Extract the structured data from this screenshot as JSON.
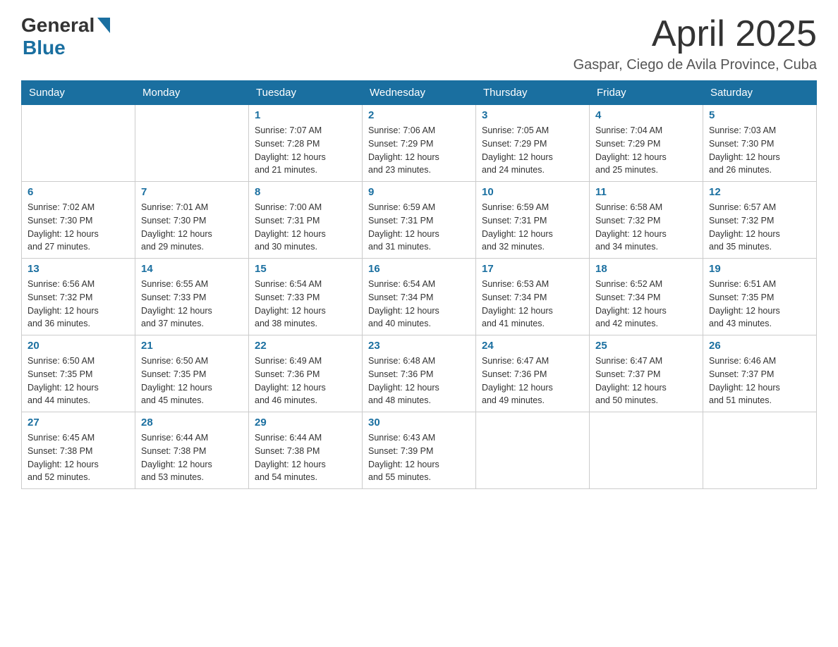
{
  "header": {
    "logo_general": "General",
    "logo_blue": "Blue",
    "title": "April 2025",
    "location": "Gaspar, Ciego de Avila Province, Cuba"
  },
  "columns": [
    "Sunday",
    "Monday",
    "Tuesday",
    "Wednesday",
    "Thursday",
    "Friday",
    "Saturday"
  ],
  "weeks": [
    [
      {
        "day": "",
        "info": ""
      },
      {
        "day": "",
        "info": ""
      },
      {
        "day": "1",
        "info": "Sunrise: 7:07 AM\nSunset: 7:28 PM\nDaylight: 12 hours\nand 21 minutes."
      },
      {
        "day": "2",
        "info": "Sunrise: 7:06 AM\nSunset: 7:29 PM\nDaylight: 12 hours\nand 23 minutes."
      },
      {
        "day": "3",
        "info": "Sunrise: 7:05 AM\nSunset: 7:29 PM\nDaylight: 12 hours\nand 24 minutes."
      },
      {
        "day": "4",
        "info": "Sunrise: 7:04 AM\nSunset: 7:29 PM\nDaylight: 12 hours\nand 25 minutes."
      },
      {
        "day": "5",
        "info": "Sunrise: 7:03 AM\nSunset: 7:30 PM\nDaylight: 12 hours\nand 26 minutes."
      }
    ],
    [
      {
        "day": "6",
        "info": "Sunrise: 7:02 AM\nSunset: 7:30 PM\nDaylight: 12 hours\nand 27 minutes."
      },
      {
        "day": "7",
        "info": "Sunrise: 7:01 AM\nSunset: 7:30 PM\nDaylight: 12 hours\nand 29 minutes."
      },
      {
        "day": "8",
        "info": "Sunrise: 7:00 AM\nSunset: 7:31 PM\nDaylight: 12 hours\nand 30 minutes."
      },
      {
        "day": "9",
        "info": "Sunrise: 6:59 AM\nSunset: 7:31 PM\nDaylight: 12 hours\nand 31 minutes."
      },
      {
        "day": "10",
        "info": "Sunrise: 6:59 AM\nSunset: 7:31 PM\nDaylight: 12 hours\nand 32 minutes."
      },
      {
        "day": "11",
        "info": "Sunrise: 6:58 AM\nSunset: 7:32 PM\nDaylight: 12 hours\nand 34 minutes."
      },
      {
        "day": "12",
        "info": "Sunrise: 6:57 AM\nSunset: 7:32 PM\nDaylight: 12 hours\nand 35 minutes."
      }
    ],
    [
      {
        "day": "13",
        "info": "Sunrise: 6:56 AM\nSunset: 7:32 PM\nDaylight: 12 hours\nand 36 minutes."
      },
      {
        "day": "14",
        "info": "Sunrise: 6:55 AM\nSunset: 7:33 PM\nDaylight: 12 hours\nand 37 minutes."
      },
      {
        "day": "15",
        "info": "Sunrise: 6:54 AM\nSunset: 7:33 PM\nDaylight: 12 hours\nand 38 minutes."
      },
      {
        "day": "16",
        "info": "Sunrise: 6:54 AM\nSunset: 7:34 PM\nDaylight: 12 hours\nand 40 minutes."
      },
      {
        "day": "17",
        "info": "Sunrise: 6:53 AM\nSunset: 7:34 PM\nDaylight: 12 hours\nand 41 minutes."
      },
      {
        "day": "18",
        "info": "Sunrise: 6:52 AM\nSunset: 7:34 PM\nDaylight: 12 hours\nand 42 minutes."
      },
      {
        "day": "19",
        "info": "Sunrise: 6:51 AM\nSunset: 7:35 PM\nDaylight: 12 hours\nand 43 minutes."
      }
    ],
    [
      {
        "day": "20",
        "info": "Sunrise: 6:50 AM\nSunset: 7:35 PM\nDaylight: 12 hours\nand 44 minutes."
      },
      {
        "day": "21",
        "info": "Sunrise: 6:50 AM\nSunset: 7:35 PM\nDaylight: 12 hours\nand 45 minutes."
      },
      {
        "day": "22",
        "info": "Sunrise: 6:49 AM\nSunset: 7:36 PM\nDaylight: 12 hours\nand 46 minutes."
      },
      {
        "day": "23",
        "info": "Sunrise: 6:48 AM\nSunset: 7:36 PM\nDaylight: 12 hours\nand 48 minutes."
      },
      {
        "day": "24",
        "info": "Sunrise: 6:47 AM\nSunset: 7:36 PM\nDaylight: 12 hours\nand 49 minutes."
      },
      {
        "day": "25",
        "info": "Sunrise: 6:47 AM\nSunset: 7:37 PM\nDaylight: 12 hours\nand 50 minutes."
      },
      {
        "day": "26",
        "info": "Sunrise: 6:46 AM\nSunset: 7:37 PM\nDaylight: 12 hours\nand 51 minutes."
      }
    ],
    [
      {
        "day": "27",
        "info": "Sunrise: 6:45 AM\nSunset: 7:38 PM\nDaylight: 12 hours\nand 52 minutes."
      },
      {
        "day": "28",
        "info": "Sunrise: 6:44 AM\nSunset: 7:38 PM\nDaylight: 12 hours\nand 53 minutes."
      },
      {
        "day": "29",
        "info": "Sunrise: 6:44 AM\nSunset: 7:38 PM\nDaylight: 12 hours\nand 54 minutes."
      },
      {
        "day": "30",
        "info": "Sunrise: 6:43 AM\nSunset: 7:39 PM\nDaylight: 12 hours\nand 55 minutes."
      },
      {
        "day": "",
        "info": ""
      },
      {
        "day": "",
        "info": ""
      },
      {
        "day": "",
        "info": ""
      }
    ]
  ]
}
